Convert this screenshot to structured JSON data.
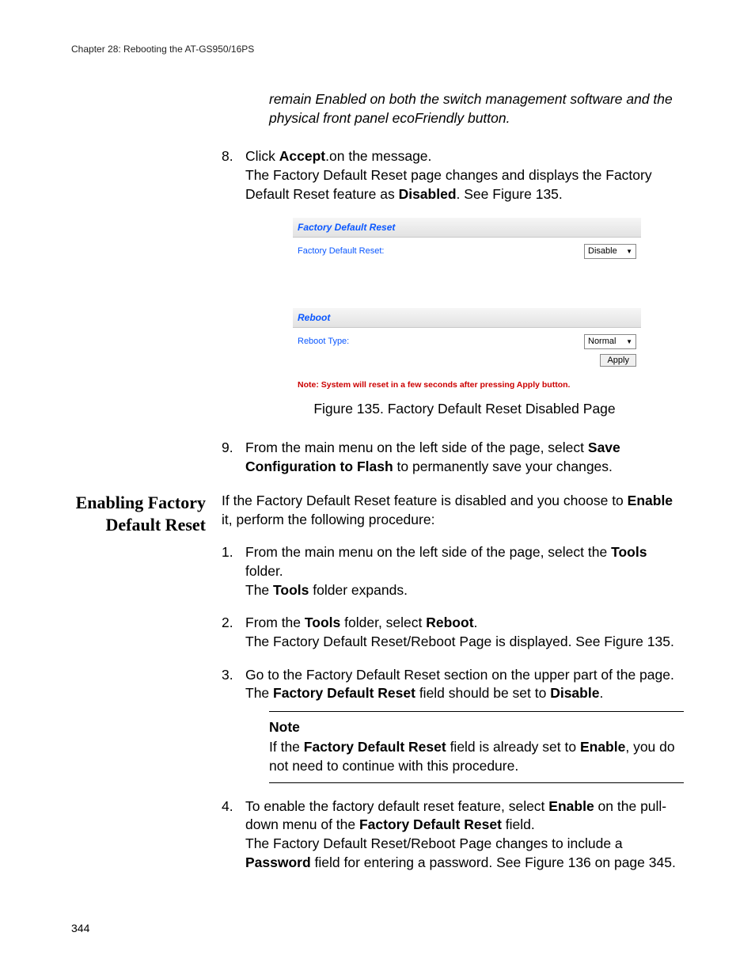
{
  "runningHead": "Chapter 28: Rebooting the AT-GS950/16PS",
  "pageNumber": "344",
  "topItalic": "remain Enabled on both the switch management software and the physical front panel ecoFriendly button.",
  "step8": {
    "num": "8.",
    "l1a": "Click ",
    "l1b": "Accept",
    "l1c": ".on the message.",
    "l2a": "The Factory Default Reset page changes and displays the Factory Default Reset feature as ",
    "l2b": "Disabled",
    "l2c": ". See Figure 135."
  },
  "uiPanel": {
    "fdrHeader": "Factory Default Reset",
    "fdrLabel": "Factory Default Reset:",
    "fdrValue": "Disable",
    "rebootHeader": "Reboot",
    "rebootLabel": "Reboot Type:",
    "rebootValue": "Normal",
    "applyBtn": "Apply",
    "note": "Note: System will reset in a few seconds after pressing Apply button."
  },
  "figCaption": "Figure 135. Factory Default Reset Disabled Page",
  "step9": {
    "num": "9.",
    "a": "From the main menu on the left side of the page, select ",
    "b": "Save Configuration to Flash",
    "c": " to permanently save your changes."
  },
  "sideHeading": "Enabling Factory Default Reset",
  "intro": {
    "a": "If the Factory Default Reset feature is disabled and you choose to ",
    "b": "Enable",
    "c": " it, perform the following procedure:"
  },
  "s1": {
    "num": "1.",
    "a": "From the main menu on the left side of the page, select the ",
    "b": "Tools",
    "c": " folder.",
    "d": "The ",
    "e": "Tools",
    "f": " folder expands."
  },
  "s2": {
    "num": "2.",
    "a": "From the ",
    "b": "Tools",
    "c": " folder, select ",
    "d": "Reboot",
    "e": ".",
    "f": "The Factory Default Reset/Reboot Page is displayed. See Figure 135."
  },
  "s3": {
    "num": "3.",
    "a": "Go to the Factory Default Reset section on the upper part of the page. The ",
    "b": "Factory Default Reset",
    "c": " field should be set to ",
    "d": "Disable",
    "e": "."
  },
  "noteBlock": {
    "head": "Note",
    "a": "If the ",
    "b": "Factory Default Reset",
    "c": " field is already set to ",
    "d": "Enable",
    "e": ", you do not need to continue with this procedure."
  },
  "s4": {
    "num": "4.",
    "a": "To enable the factory default reset feature, select ",
    "b": "Enable",
    "c": " on the pull-down menu of the ",
    "d": "Factory Default Reset",
    "e": " field.",
    "f": "The Factory Default Reset/Reboot Page changes to include a ",
    "g": "Password",
    "h": " field for entering a password. See Figure 136 on page 345."
  }
}
